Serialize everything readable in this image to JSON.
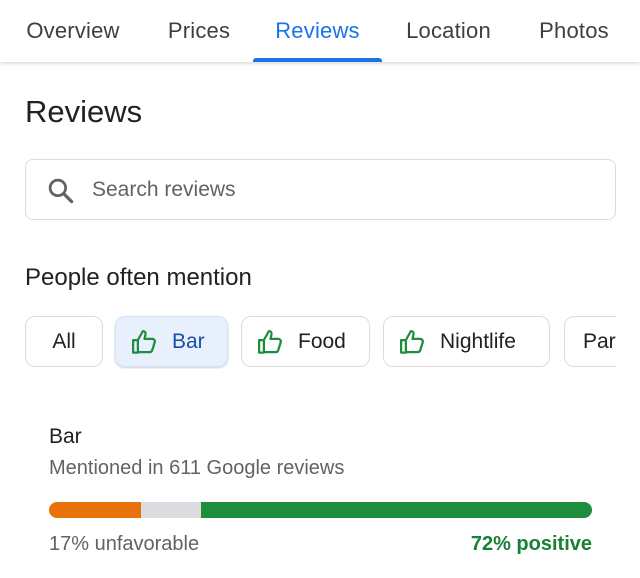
{
  "tabs": [
    {
      "label": "Overview",
      "active": false
    },
    {
      "label": "Prices",
      "active": false
    },
    {
      "label": "Reviews",
      "active": true
    },
    {
      "label": "Location",
      "active": false
    },
    {
      "label": "Photos",
      "active": false
    }
  ],
  "section_title": "Reviews",
  "search": {
    "placeholder": "Search reviews",
    "value": "",
    "icon": "search-icon"
  },
  "mentions": {
    "title": "People often mention",
    "chips": [
      {
        "label": "All",
        "icon": "",
        "selected": false
      },
      {
        "label": "Bar",
        "icon": "thumbs-up-icon",
        "selected": true
      },
      {
        "label": "Food",
        "icon": "thumbs-up-icon",
        "selected": false
      },
      {
        "label": "Nightlife",
        "icon": "thumbs-up-icon",
        "selected": false
      },
      {
        "label": "Par",
        "icon": "",
        "selected": false
      }
    ]
  },
  "detail": {
    "name": "Bar",
    "mentioned": "Mentioned in 611 Google reviews",
    "unfavorable_pct": 17,
    "neutral_pct": 11,
    "positive_pct": 72,
    "unfavorable_label": "17% unfavorable",
    "positive_label": "72% positive"
  },
  "colors": {
    "accent": "#1a73e8",
    "unfavorable": "#e8710a",
    "neutral": "#dadce0",
    "positive": "#1e8e3e",
    "positive_text": "#188038",
    "thumb_icon": "#1e8e3e"
  }
}
